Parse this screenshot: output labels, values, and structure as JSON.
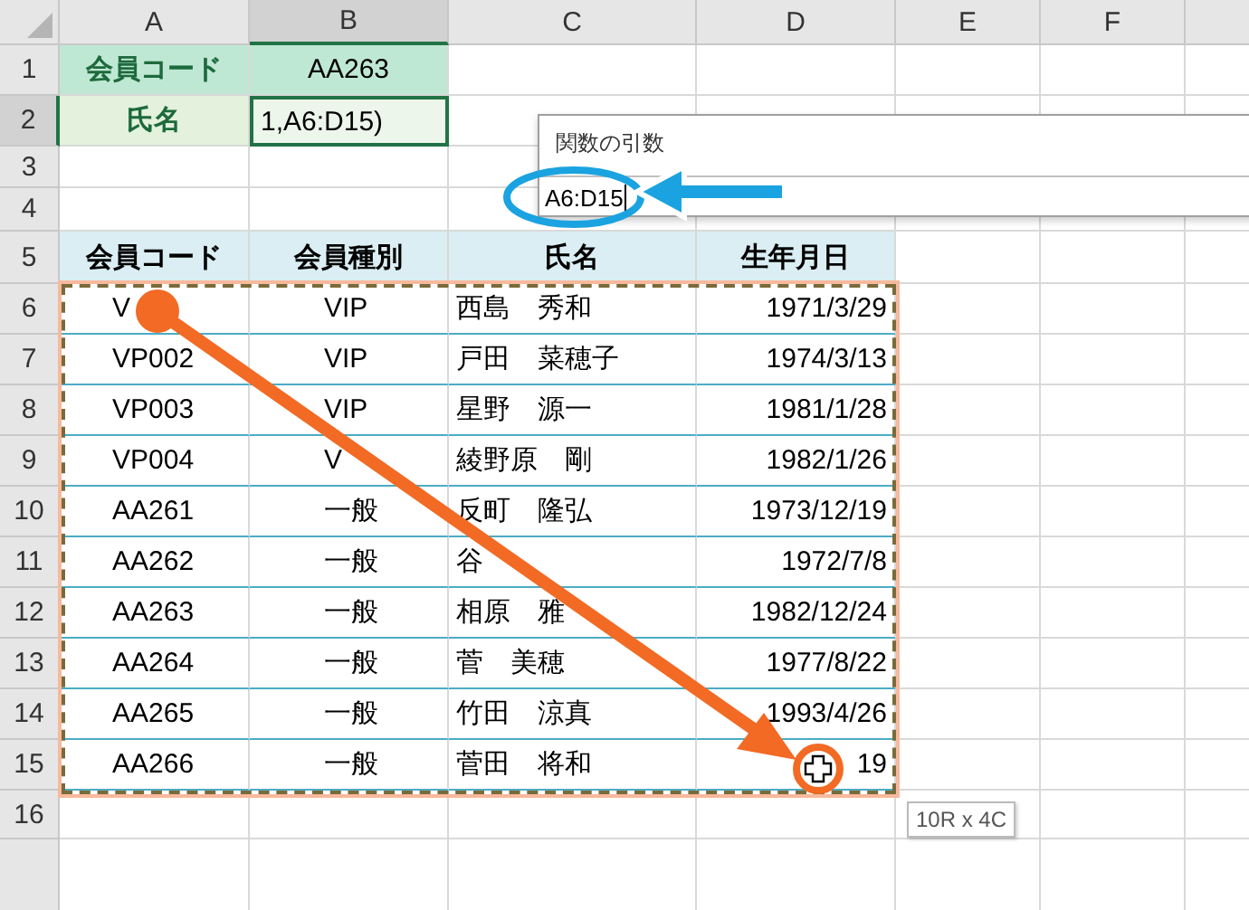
{
  "column_headers": [
    "A",
    "B",
    "C",
    "D",
    "E",
    "F"
  ],
  "row_headers": [
    "1",
    "2",
    "3",
    "4",
    "5",
    "6",
    "7",
    "8",
    "9",
    "10",
    "11",
    "12",
    "13",
    "14",
    "15",
    "16"
  ],
  "lookup": [
    {
      "label": "会員コード",
      "value": "AA263",
      "editing": false
    },
    {
      "label": "氏名",
      "value": "1,A6:D15)",
      "editing": true
    }
  ],
  "table": {
    "columns": [
      "会員コード",
      "会員種別",
      "氏名",
      "生年月日"
    ],
    "rows": [
      [
        "V",
        "VIP",
        "西島　秀和",
        "1971/3/29"
      ],
      [
        "VP002",
        "VIP",
        "戸田　菜穂子",
        "1974/3/13"
      ],
      [
        "VP003",
        "VIP",
        "星野　源一",
        "1981/1/28"
      ],
      [
        "VP004",
        "V",
        "綾野原　剛",
        "1982/1/26"
      ],
      [
        "AA261",
        "一般",
        "反町　隆弘",
        "1973/12/19"
      ],
      [
        "AA262",
        "一般",
        "谷",
        "1972/7/8"
      ],
      [
        "AA263",
        "一般",
        "相原　雅",
        "1982/12/24"
      ],
      [
        "AA264",
        "一般",
        "菅　美穂",
        "1977/8/22"
      ],
      [
        "AA265",
        "一般",
        "竹田　涼真",
        "1993/4/26"
      ],
      [
        "AA266",
        "一般",
        "菅田　将和",
        "19"
      ]
    ]
  },
  "function_arguments": {
    "title": "関数の引数",
    "value": "A6:D15"
  },
  "selection_tooltip": "10R x 4C"
}
